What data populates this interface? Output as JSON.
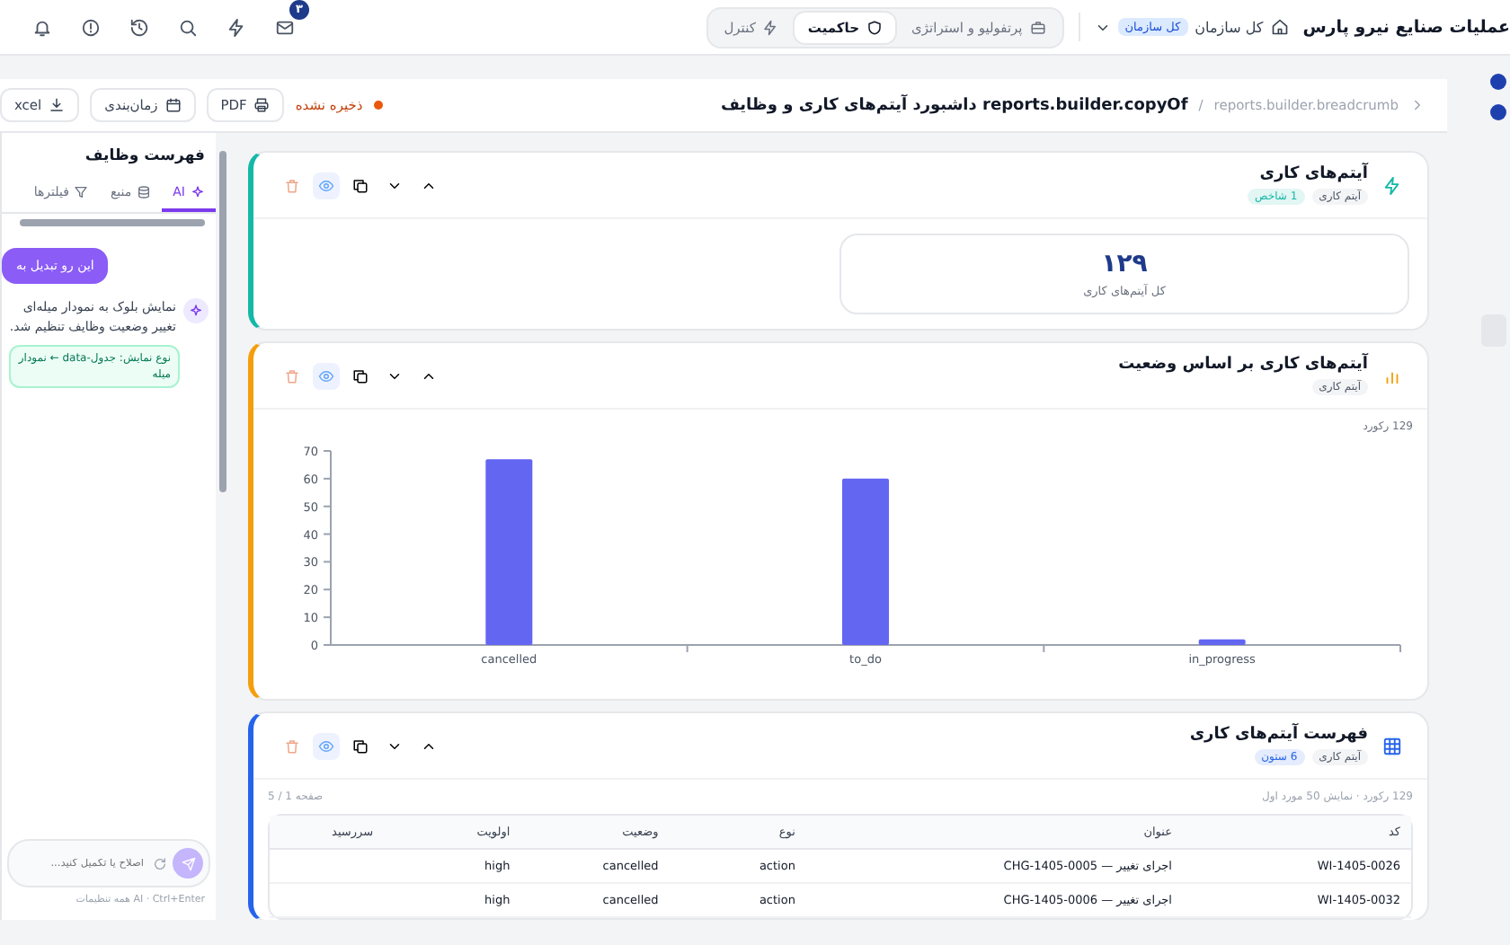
{
  "top_bar": {
    "org_title": "عملیات صنایع نیرو پارس",
    "scope": {
      "label": "کل سازمان",
      "badge": "کل سازمان"
    },
    "modes": [
      {
        "label": "پرتفولیو و استراتژی",
        "selected": false
      },
      {
        "label": "حاکمیت",
        "selected": true
      },
      {
        "label": "کنترل",
        "selected": false
      }
    ],
    "mail_badge": "۳"
  },
  "toolbar": {
    "breadcrumb": "reports.builder.breadcrumb",
    "separator": "/",
    "title": "reports.builder.copyOf داشبورد آیتم‌های کاری و وظایف",
    "save_status": "ذخیره نشده",
    "buttons": [
      {
        "label": "PDF"
      },
      {
        "label": "زمان‌بندی"
      },
      {
        "label": "xcel"
      }
    ]
  },
  "left_panel": {
    "title": "فهرست وظایف",
    "tabs": [
      {
        "label": "AI",
        "selected": true
      },
      {
        "label": "منبع",
        "selected": false
      },
      {
        "label": "فیلترها",
        "selected": false
      }
    ],
    "user_message": "این رو تبدیل به",
    "ai_message": "نمایش بلوک به نمودار میله‌ای تغییر وضعیت وظایف تنظیم شد.",
    "change_chip": "نوع نمایش: جدول-data ← نمودار میله",
    "input": {
      "placeholder": "اصلاح یا تکمیل کنید..."
    },
    "footer": "AI · Ctrl+Enter همه تنظیمات"
  },
  "cards": [
    {
      "kind": "kpi",
      "color": "#14b8a6",
      "title": "آیتم‌های کاری",
      "tags": [
        "آیتم کاری",
        "1 شاخص"
      ],
      "stat": {
        "value": "۱۲۹",
        "label": "کل آیتم‌های کاری"
      }
    },
    {
      "kind": "chart",
      "color": "#f59e0b",
      "title": "آیتم‌های کاری بر اساس وضعیت",
      "tags": [
        "آیتم کاری"
      ],
      "record_count": "129 رکورد",
      "chart_data": {
        "type": "bar",
        "categories": [
          "cancelled",
          "to_do",
          "in_progress"
        ],
        "series": [
          {
            "color": "#6366f1",
            "values": [
              67,
              60,
              2
            ]
          }
        ],
        "ylim": [
          0,
          70
        ],
        "yticks": [
          0,
          10,
          20,
          30,
          40,
          50,
          60,
          70
        ]
      }
    },
    {
      "kind": "table",
      "color": "#2563eb",
      "title": "فهرست آیتم‌های کاری",
      "tags": [
        "آیتم کاری",
        "6 ستون"
      ],
      "info": "129 رکورد · نمایش 50 مورد اول",
      "page": "صفحه 1 / 5",
      "columns": [
        "کد",
        "عنوان",
        "نوع",
        "وضعیت",
        "اولویت",
        "سررسید"
      ],
      "rows": [
        [
          "WI-1405-0026",
          "اجرای تغییر — CHG-1405-0005",
          "action",
          "cancelled",
          "high"
        ],
        [
          "WI-1405-0032",
          "اجرای تغییر — CHG-1405-0006",
          "action",
          "cancelled",
          "high"
        ]
      ]
    }
  ]
}
